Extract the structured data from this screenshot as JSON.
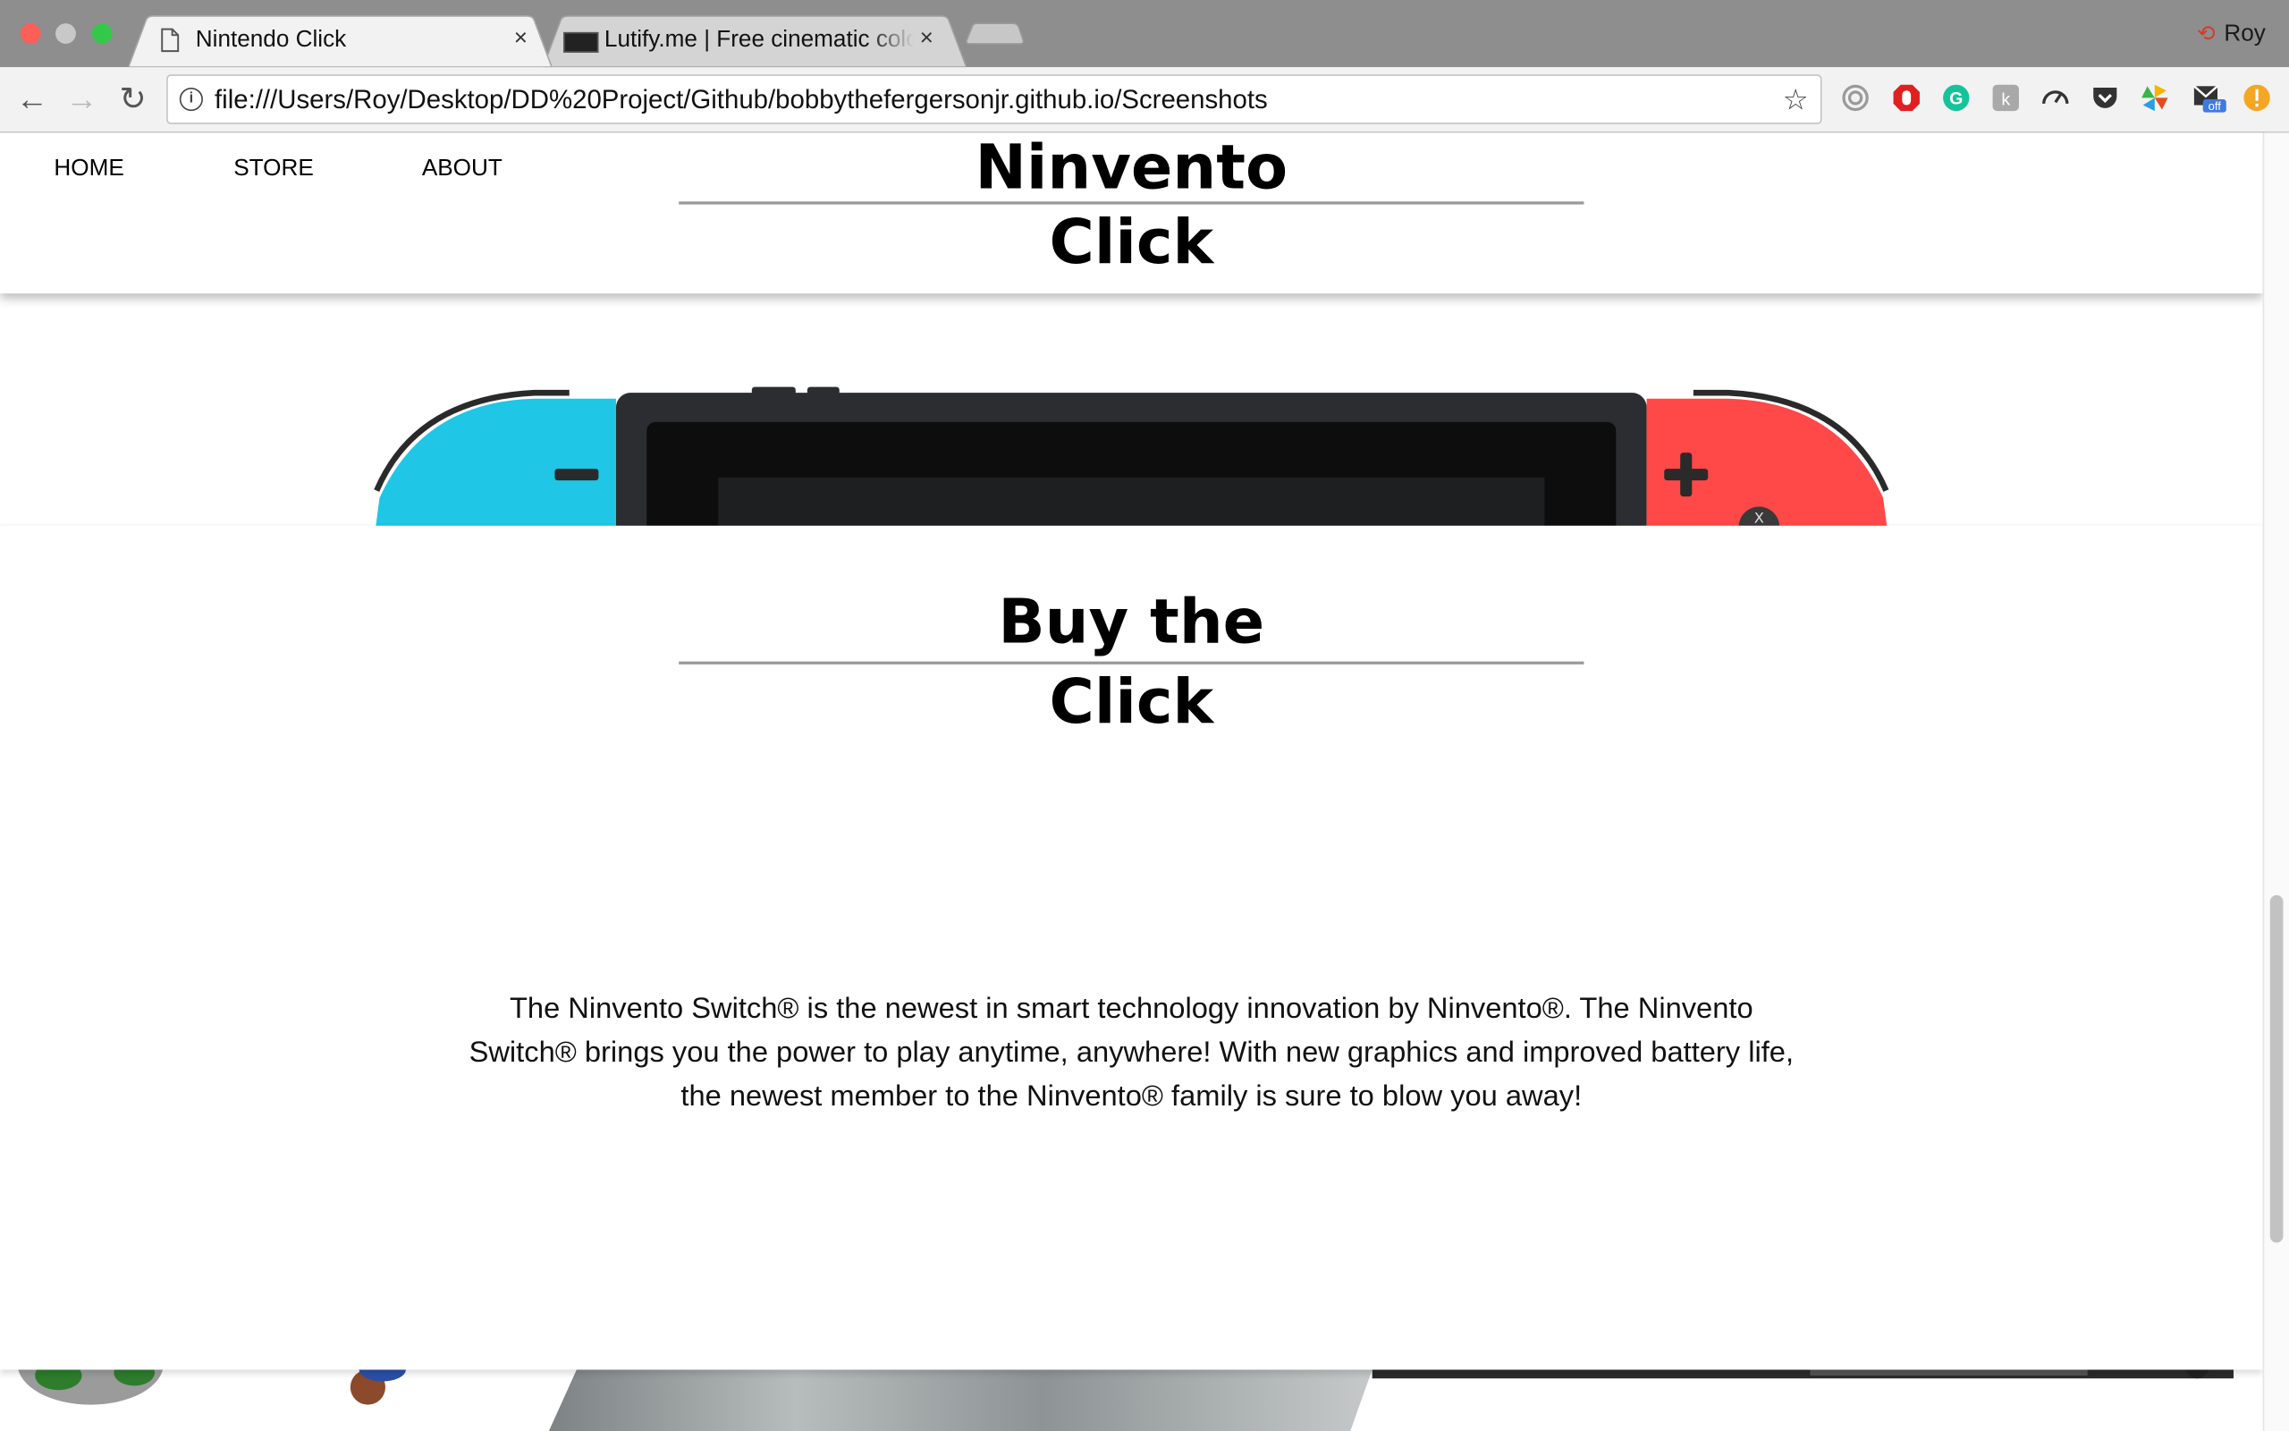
{
  "browser": {
    "tabs": [
      {
        "title": "Nintendo Click",
        "active": true
      },
      {
        "title": "Lutify.me | Free cinematic color",
        "active": false
      }
    ],
    "tab_close_glyph": "×",
    "profile_name": "Roy",
    "url": "file:///Users/Roy/Desktop/DD%20Project/Github/bobbythefergersonjr.github.io/Screenshots",
    "extension_badge": "off",
    "extensions": [
      "ghostery-icon",
      "adblock-icon",
      "grammarly-icon",
      "keyboard-icon",
      "speedometer-icon",
      "pocket-icon",
      "pinwheel-icon",
      "mail-icon",
      "alert-icon"
    ]
  },
  "site": {
    "nav": [
      "HOME",
      "STORE",
      "ABOUT"
    ],
    "brand": {
      "line1": "Ninvento",
      "line2": "Click"
    },
    "buy_heading": {
      "line1": "Buy the",
      "line2": "Click"
    },
    "description": "The Ninvento Switch® is the newest in smart technology innovation by Ninvento®. The Ninvento Switch® brings you the power to play anytime, anywhere! With new graphics and improved battery life, the newest member to the Ninvento® family is sure to blow you away!"
  },
  "colors": {
    "joycon_left": "#1fc6e6",
    "joycon_right": "#ff4848",
    "console_body": "#2b2d30"
  }
}
